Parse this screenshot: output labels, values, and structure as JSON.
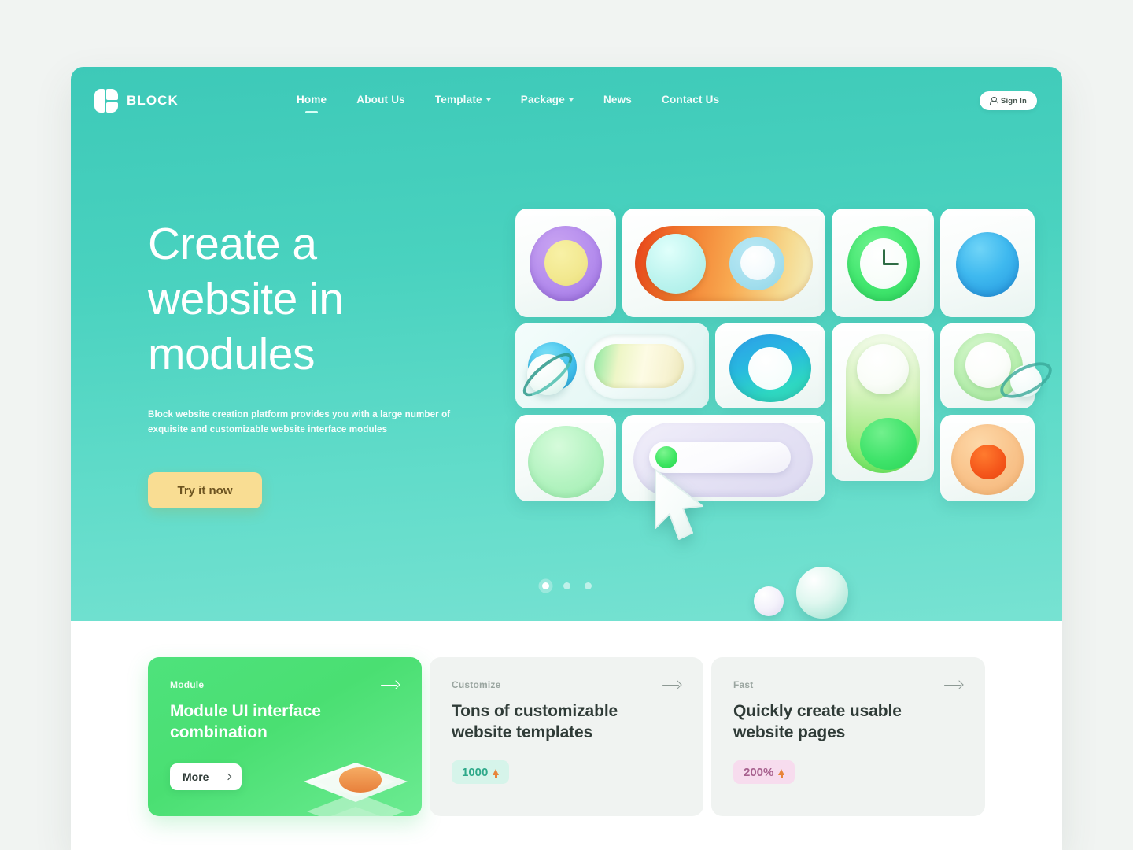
{
  "brand": {
    "name": "BLOCK",
    "logo_icon": "block-logo-icon"
  },
  "nav": {
    "items": [
      {
        "label": "Home",
        "has_caret": false,
        "active": true
      },
      {
        "label": "About Us",
        "has_caret": false,
        "active": false
      },
      {
        "label": "Template",
        "has_caret": true,
        "active": false
      },
      {
        "label": "Package",
        "has_caret": true,
        "active": false
      },
      {
        "label": "News",
        "has_caret": false,
        "active": false
      },
      {
        "label": "Contact Us",
        "has_caret": false,
        "active": false
      }
    ],
    "signin": {
      "label": "Sign In",
      "icon": "user-icon"
    }
  },
  "hero": {
    "title_line1": "Create a",
    "title_line2": "website in",
    "title_line3": "modules",
    "subtitle": "Block website creation platform provides you with a large number of exquisite and customizable website interface modules",
    "cta_label": "Try it now",
    "background_color": "#49d2bf",
    "cta_color": "#f9dd93",
    "carousel": {
      "total": 3,
      "active_index": 0
    }
  },
  "cards": [
    {
      "kicker": "Module",
      "title": "Module UI interface combination",
      "arrow_icon": "arrow-right-icon",
      "button_label": "More",
      "button_icon": "chevron-right-icon",
      "style": "accent",
      "accent_color": "#4adf72"
    },
    {
      "kicker": "Customize",
      "title": "Tons of customizable website templates",
      "arrow_icon": "arrow-right-icon",
      "badge_value": "1000",
      "badge_icon": "arrow-up-icon",
      "badge_style": "mint",
      "style": "plain"
    },
    {
      "kicker": "Fast",
      "title": "Quickly create usable website pages",
      "arrow_icon": "arrow-right-icon",
      "badge_value": "200%",
      "badge_icon": "arrow-up-icon",
      "badge_style": "pink",
      "style": "plain"
    }
  ]
}
